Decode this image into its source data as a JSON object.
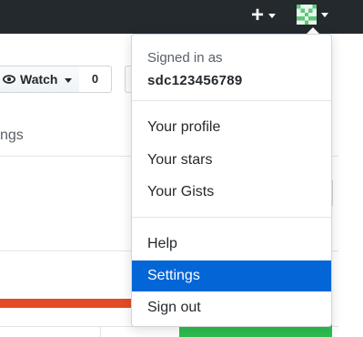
{
  "header": {
    "plus_icon": "+",
    "avatar_alt": "identicon"
  },
  "repo": {
    "watch_label": "Watch",
    "watch_count": "0",
    "settings_tab": "tings"
  },
  "user_menu": {
    "signed_in_as": "Signed in as",
    "username": "sdc123456789",
    "items": [
      {
        "label": "Your profile"
      },
      {
        "label": "Your stars"
      },
      {
        "label": "Your Gists"
      },
      {
        "label": "Help"
      },
      {
        "label": "Settings",
        "active": true
      },
      {
        "label": "Sign out"
      }
    ]
  },
  "colors": {
    "header_bg": "#24292e",
    "highlight": "#0366d6",
    "language_bar": "#e34c26",
    "green_button": "#2cbe4e",
    "identicon": "#5cc97a"
  }
}
